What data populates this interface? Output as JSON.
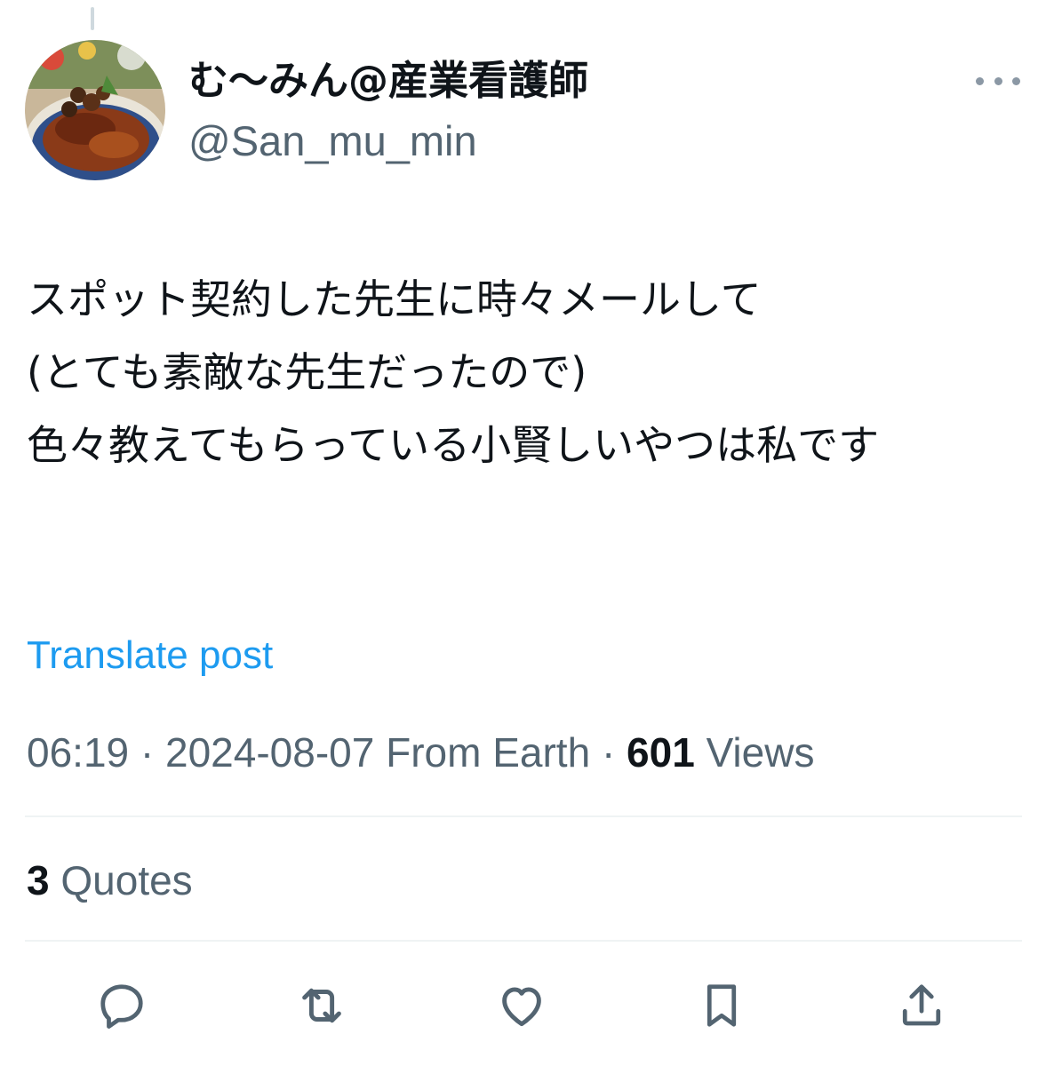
{
  "author": {
    "display_name": "む〜みん@産業看護師",
    "handle": "@San_mu_min",
    "avatar_icon": "food-photo-avatar"
  },
  "post": {
    "text": "スポット契約した先生に時々メールして\n(とても素敵な先生だったので)\n色々教えてもらっている小賢しいやつは私です"
  },
  "translate_label": "Translate post",
  "meta": {
    "time": "06:19",
    "separator": "·",
    "date": "2024-08-07",
    "source": "From Earth",
    "views_count": "601",
    "views_label": "Views"
  },
  "quotes": {
    "count": "3",
    "label": "Quotes"
  },
  "actions": [
    {
      "icon": "reply-icon"
    },
    {
      "icon": "repost-icon"
    },
    {
      "icon": "like-icon"
    },
    {
      "icon": "bookmark-icon"
    },
    {
      "icon": "share-icon"
    }
  ],
  "colors": {
    "text_primary": "#0f1419",
    "text_secondary": "#536471",
    "link": "#1d9bf0",
    "divider": "#eff3f4"
  }
}
